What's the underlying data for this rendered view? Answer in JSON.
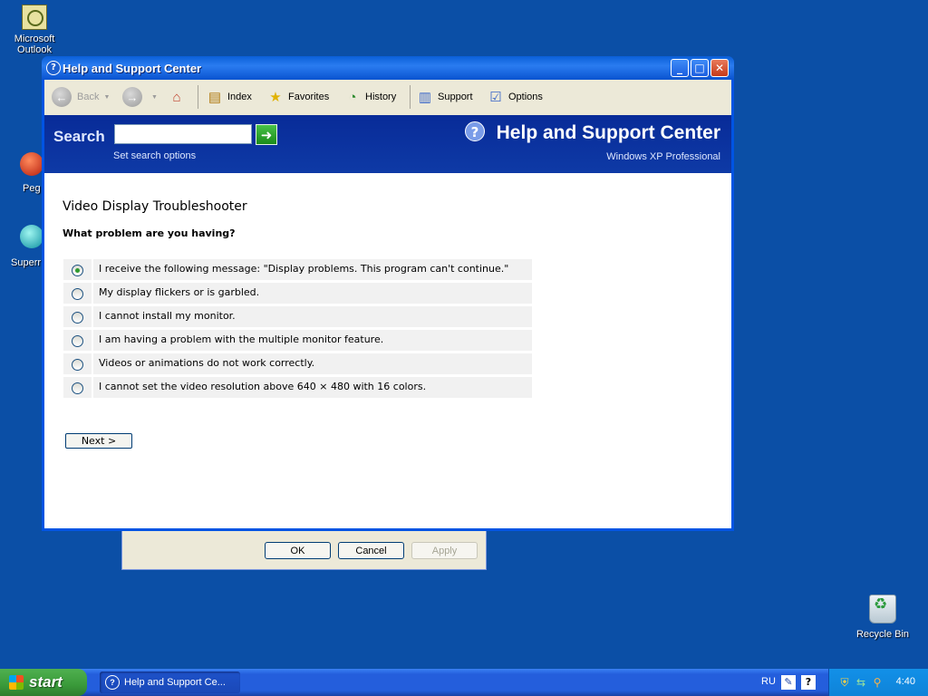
{
  "desktop": {
    "icons": [
      {
        "label": "Microsoft Outlook"
      },
      {
        "label": "Peg"
      },
      {
        "label": "Superr"
      },
      {
        "label": "Recycle Bin"
      }
    ]
  },
  "background_dialog": {
    "ok_label": "OK",
    "cancel_label": "Cancel",
    "apply_label": "Apply"
  },
  "window": {
    "title": "Help and Support Center",
    "caption_buttons": {
      "minimize": "_",
      "maximize": "□",
      "close": "✕"
    },
    "toolbar": {
      "back": "Back",
      "index": "Index",
      "favorites": "Favorites",
      "history": "History",
      "support": "Support",
      "options": "Options"
    },
    "header": {
      "search_label": "Search",
      "search_value": "",
      "search_options": "Set search options",
      "brand_title": "Help and Support Center",
      "brand_subtitle": "Windows XP Professional"
    },
    "content": {
      "title": "Video Display Troubleshooter",
      "question": "What problem are you having?",
      "options": [
        {
          "label": "I receive the following message: \"Display problems. This program can't continue.\"",
          "selected": true
        },
        {
          "label": "My display flickers or is garbled.",
          "selected": false
        },
        {
          "label": "I cannot install my monitor.",
          "selected": false
        },
        {
          "label": "I am having a problem with the multiple monitor feature.",
          "selected": false
        },
        {
          "label": "Videos or animations do not work correctly.",
          "selected": false
        },
        {
          "label": "I cannot set the video resolution above 640 × 480 with 16 colors.",
          "selected": false
        }
      ],
      "next_label": "Next  >"
    }
  },
  "taskbar": {
    "start_label": "start",
    "task_label": "Help and Support Ce...",
    "language": "RU",
    "clock": "4:40"
  }
}
